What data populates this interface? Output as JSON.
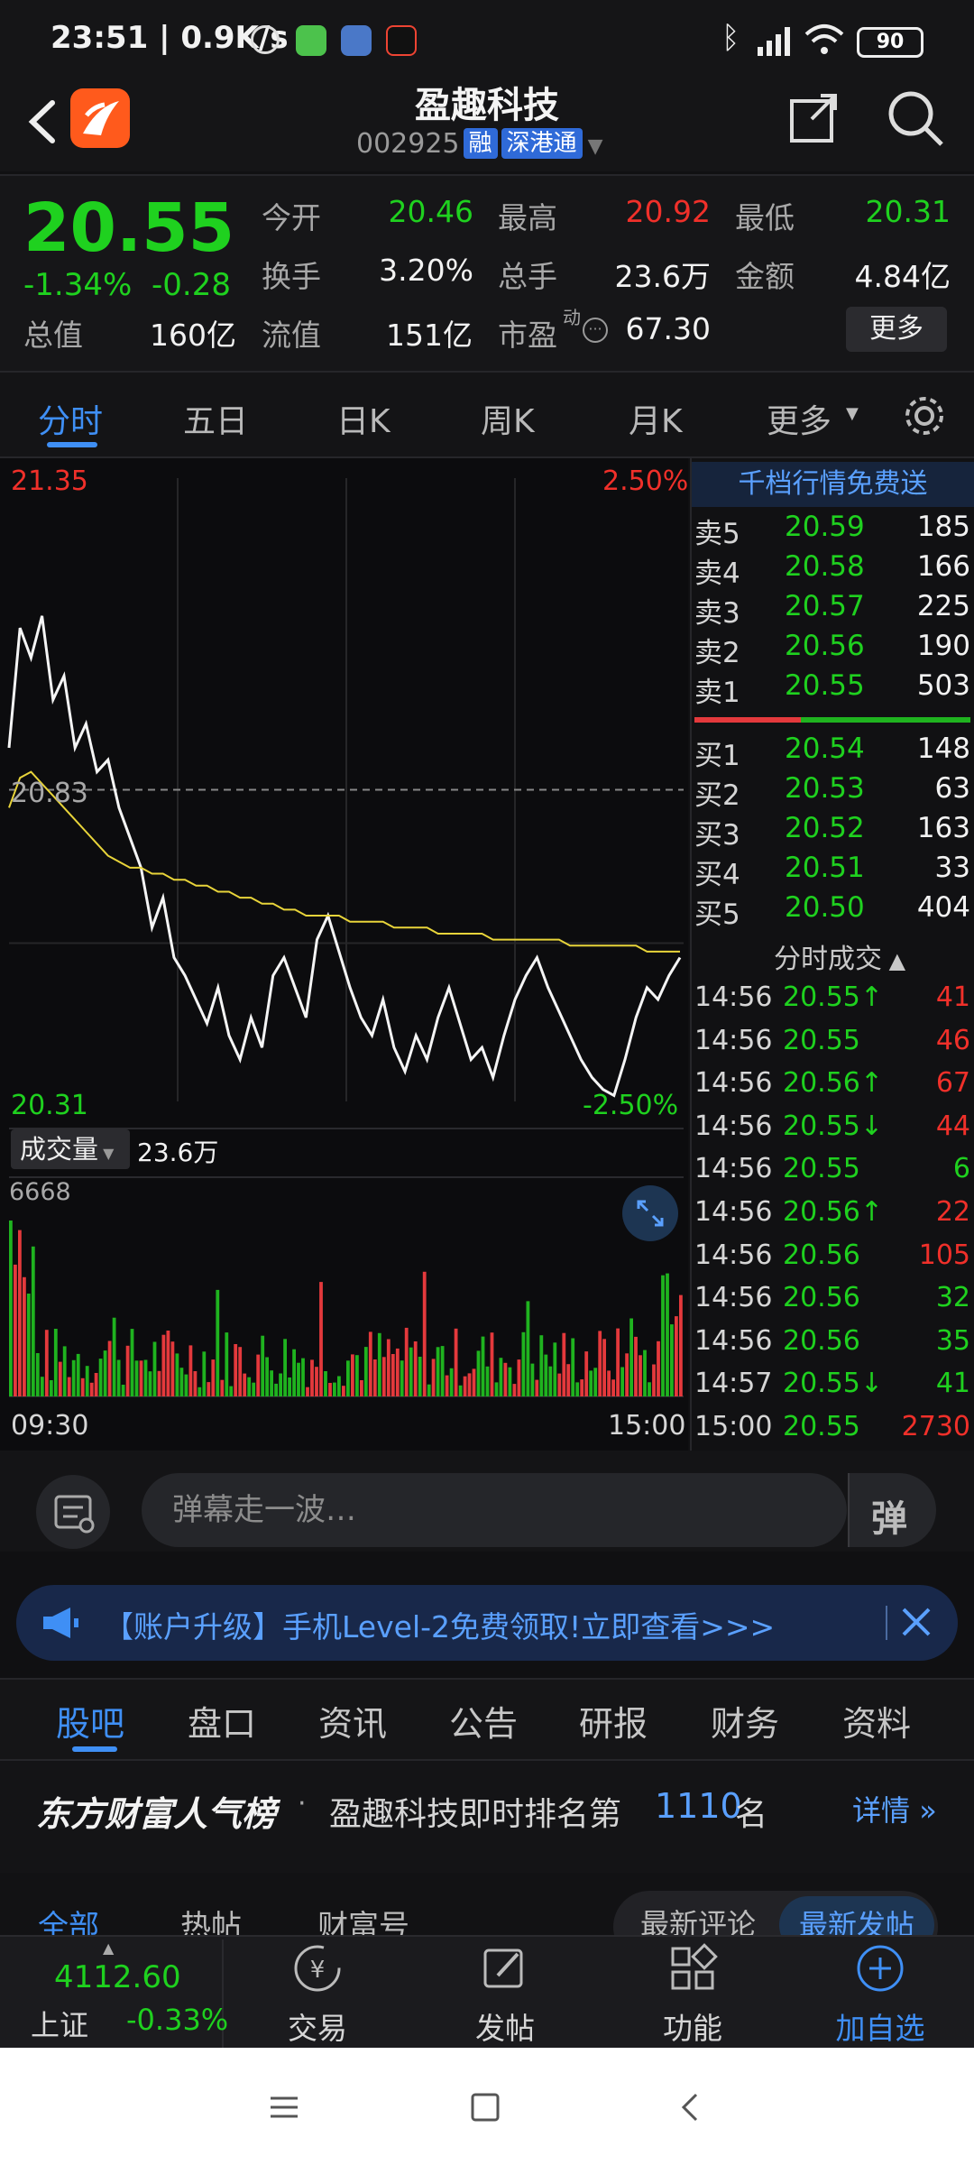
{
  "status_bar": {
    "time": "23:51 | 0.9K/s",
    "battery": "90"
  },
  "header": {
    "title": "盈趣科技",
    "code": "002925",
    "tag1": "融",
    "tag2": "深港通"
  },
  "quote": {
    "price": "20.55",
    "change_pct": "-1.34%",
    "change": "-0.28",
    "rows": [
      [
        [
          "今开",
          "20.46",
          "green"
        ],
        [
          "最高",
          "20.92",
          "red"
        ],
        [
          "最低",
          "20.31",
          "green"
        ]
      ],
      [
        [
          "换手",
          "3.20%",
          "white"
        ],
        [
          "总手",
          "23.6万",
          "white"
        ],
        [
          "金额",
          "4.84亿",
          "white"
        ]
      ],
      [
        [
          "总值",
          "160亿",
          "white"
        ],
        [
          "流值",
          "151亿",
          "white"
        ],
        [
          "市盈",
          "67.30",
          "white"
        ]
      ]
    ],
    "pe_superscript": "动",
    "more_label": "更多"
  },
  "tabs": [
    "分时",
    "五日",
    "日K",
    "周K",
    "月K",
    "更多"
  ],
  "chart": {
    "price_max": "21.35",
    "price_min": "20.31",
    "pct_max": "2.50%",
    "pct_min": "-2.50%",
    "prev_close": "20.83",
    "volume_label": "成交量",
    "volume_total": "23.6万",
    "volume_max": "6668",
    "time_start": "09:30",
    "time_end": "15:00"
  },
  "chart_data": {
    "type": "line",
    "title": "",
    "series": [
      {
        "name": "price",
        "values": [
          20.9,
          21.1,
          21.05,
          21.12,
          20.98,
          21.02,
          20.9,
          20.94,
          20.86,
          20.88,
          20.8,
          20.75,
          20.7,
          20.6,
          20.65,
          20.55,
          20.52,
          20.48,
          20.44,
          20.5,
          20.42,
          20.38,
          20.45,
          20.4,
          20.52,
          20.55,
          20.5,
          20.45,
          20.58,
          20.62,
          20.56,
          20.5,
          20.45,
          20.42,
          20.48,
          20.4,
          20.36,
          20.42,
          20.38,
          20.45,
          20.5,
          20.44,
          20.38,
          20.4,
          20.35,
          20.42,
          20.48,
          20.52,
          20.55,
          20.5,
          20.46,
          20.42,
          20.38,
          20.35,
          20.33,
          20.32,
          20.38,
          20.45,
          20.5,
          20.48,
          20.52,
          20.55
        ]
      },
      {
        "name": "avg",
        "values": [
          20.8,
          20.85,
          20.86,
          20.84,
          20.82,
          20.8,
          20.78,
          20.76,
          20.74,
          20.72,
          20.71,
          20.7,
          20.7,
          20.69,
          20.69,
          20.68,
          20.68,
          20.67,
          20.67,
          20.66,
          20.66,
          20.65,
          20.65,
          20.64,
          20.64,
          20.63,
          20.63,
          20.62,
          20.62,
          20.62,
          20.62,
          20.61,
          20.61,
          20.61,
          20.61,
          20.6,
          20.6,
          20.6,
          20.6,
          20.59,
          20.59,
          20.59,
          20.59,
          20.59,
          20.58,
          20.58,
          20.58,
          20.58,
          20.58,
          20.58,
          20.58,
          20.57,
          20.57,
          20.57,
          20.57,
          20.57,
          20.57,
          20.57,
          20.56,
          20.56,
          20.56,
          20.56
        ]
      }
    ],
    "ylim": [
      20.31,
      21.35
    ]
  },
  "order_book": {
    "header": "千档行情免费送",
    "sells": [
      [
        "卖5",
        "20.59",
        "185"
      ],
      [
        "卖4",
        "20.58",
        "166"
      ],
      [
        "卖3",
        "20.57",
        "225"
      ],
      [
        "卖2",
        "20.56",
        "190"
      ],
      [
        "卖1",
        "20.55",
        "503"
      ]
    ],
    "buys": [
      [
        "买1",
        "20.54",
        "148"
      ],
      [
        "买2",
        "20.53",
        "63"
      ],
      [
        "买3",
        "20.52",
        "163"
      ],
      [
        "买4",
        "20.51",
        "33"
      ],
      [
        "买5",
        "20.50",
        "404"
      ]
    ]
  },
  "ticks": {
    "header": "分时成交",
    "rows": [
      [
        "14:56",
        "20.55↑",
        "41",
        "red"
      ],
      [
        "14:56",
        "20.55",
        "46",
        "red"
      ],
      [
        "14:56",
        "20.56↑",
        "67",
        "red"
      ],
      [
        "14:56",
        "20.55↓",
        "44",
        "red"
      ],
      [
        "14:56",
        "20.55",
        "6",
        "green"
      ],
      [
        "14:56",
        "20.56↑",
        "22",
        "red"
      ],
      [
        "14:56",
        "20.56",
        "105",
        "red"
      ],
      [
        "14:56",
        "20.56",
        "32",
        "green"
      ],
      [
        "14:56",
        "20.56",
        "35",
        "green"
      ],
      [
        "14:57",
        "20.55↓",
        "41",
        "green"
      ],
      [
        "15:00",
        "20.55",
        "2730",
        "red"
      ]
    ]
  },
  "danmaku": {
    "placeholder": "弹幕走一波…",
    "toggle": "弹"
  },
  "promo": {
    "text": "【账户升级】手机Level-2免费领取!立即查看>>>"
  },
  "tabs2": [
    "股吧",
    "盘口",
    "资讯",
    "公告",
    "研报",
    "财务",
    "资料"
  ],
  "rank": {
    "brand": "东方财富人气榜",
    "text_before": "盈趣科技即时排名第",
    "rank_no": "1110",
    "text_after": "名",
    "detail": "详情"
  },
  "filters": {
    "left": [
      "全部",
      "热帖",
      "财富号"
    ],
    "right": [
      "最新评论",
      "最新发帖"
    ]
  },
  "bottom_nav": {
    "index_value": "4112.60",
    "index_name": "上证",
    "index_change": "-0.33%",
    "items": [
      "交易",
      "发帖",
      "功能",
      "加自选"
    ]
  }
}
